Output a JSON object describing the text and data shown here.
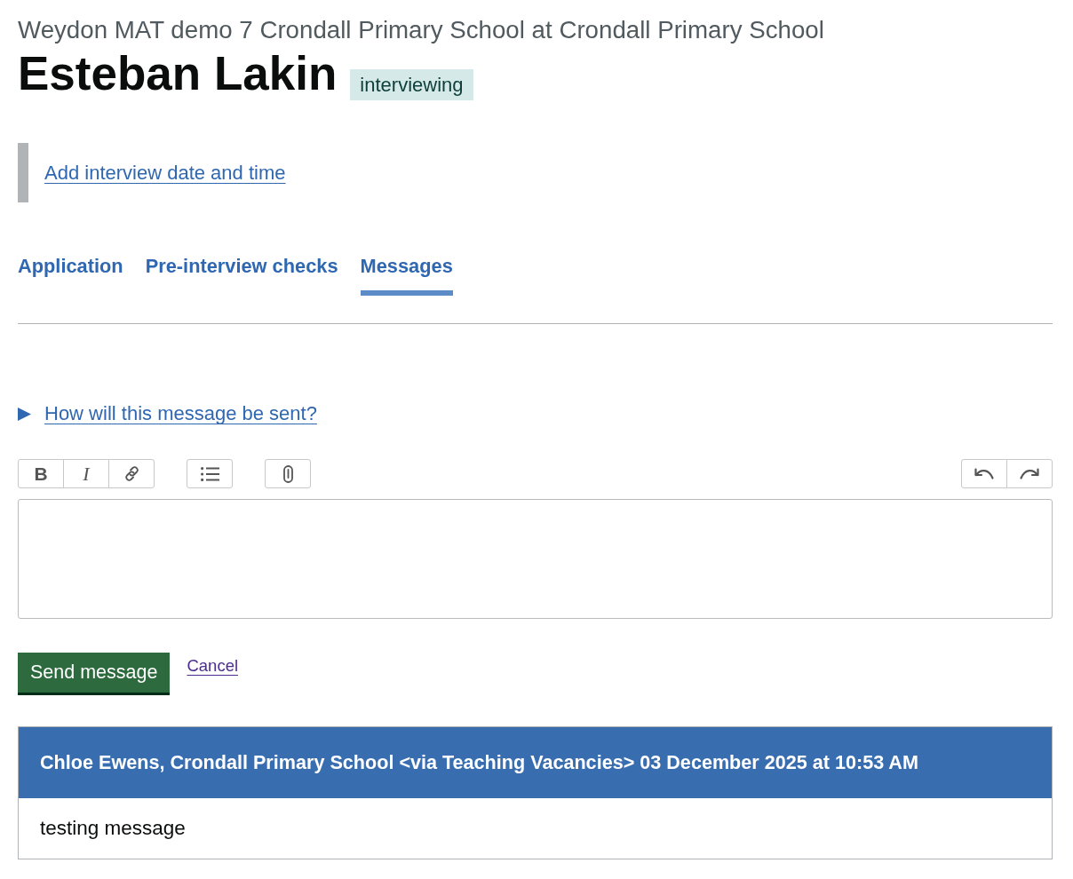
{
  "caption": "Weydon MAT demo 7 Crondall Primary School at Crondall Primary School",
  "heading": "Esteban Lakin",
  "status_tag": "interviewing",
  "inset": {
    "link": "Add interview date and time"
  },
  "tabs": [
    {
      "label": "Application",
      "selected": false
    },
    {
      "label": "Pre-interview checks",
      "selected": false
    },
    {
      "label": "Messages",
      "selected": true
    }
  ],
  "details": {
    "summary": "How will this message be sent?",
    "expanded": false
  },
  "toolbar": {
    "left_groups": [
      {
        "buttons": [
          {
            "kind": "bold",
            "label": "B"
          },
          {
            "kind": "italic",
            "label": "I"
          },
          {
            "kind": "link"
          }
        ]
      },
      {
        "buttons": [
          {
            "kind": "bullets"
          }
        ]
      },
      {
        "buttons": [
          {
            "kind": "attach"
          }
        ]
      }
    ],
    "right_groups": [
      {
        "buttons": [
          {
            "kind": "undo"
          },
          {
            "kind": "redo"
          }
        ]
      }
    ]
  },
  "actions": {
    "send_button": "Send message",
    "cancel_link": {
      "label": "Cancel",
      "visited": true
    }
  },
  "messages": [
    {
      "header": "Chloe Ewens, Crondall Primary School <via Teaching Vacancies> 03 December 2025 at 10:53 AM",
      "body": "testing message"
    }
  ]
}
